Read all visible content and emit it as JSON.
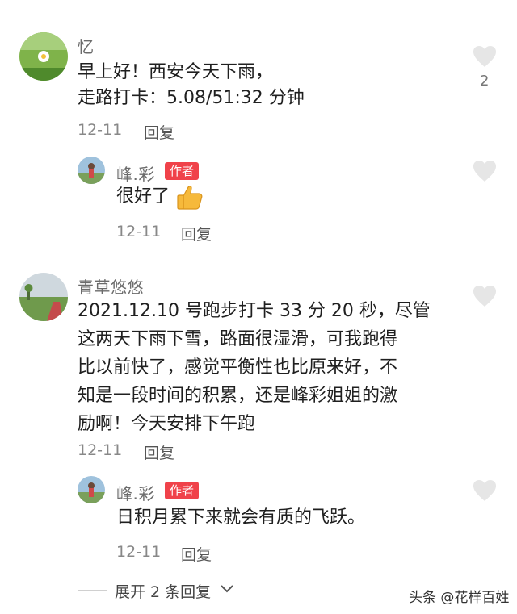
{
  "comments": [
    {
      "author": "忆",
      "text_lines": [
        "早上好！西安今天下雨，",
        "走路打卡：5.08/51:32 分钟"
      ],
      "date": "12-11",
      "reply_label": "回复",
      "likes": "2",
      "replies": [
        {
          "author": "峰.彩",
          "badge": "作者",
          "text": "很好了",
          "emoji": "thumbs-up",
          "date": "12-11",
          "reply_label": "回复"
        }
      ]
    },
    {
      "author": "青草悠悠",
      "text_lines": [
        "2021.12.10 号跑步打卡 33 分 20 秒，尽管",
        "这两天下雨下雪，路面很湿滑，可我跑得",
        "比以前快了，感觉平衡性也比原来好，不",
        "知是一段时间的积累，还是峰彩姐姐的激",
        "励啊！今天安排下午跑"
      ],
      "date": "12-11",
      "reply_label": "回复",
      "replies": [
        {
          "author": "峰.彩",
          "badge": "作者",
          "text": "日积月累下来就会有质的飞跃。",
          "date": "12-11",
          "reply_label": "回复"
        }
      ]
    }
  ],
  "expand_replies_label": "展开 2 条回复",
  "watermark": "头条 @花样百姓",
  "colors": {
    "badge": "#f0424a",
    "heart": "#e6e6e6"
  }
}
